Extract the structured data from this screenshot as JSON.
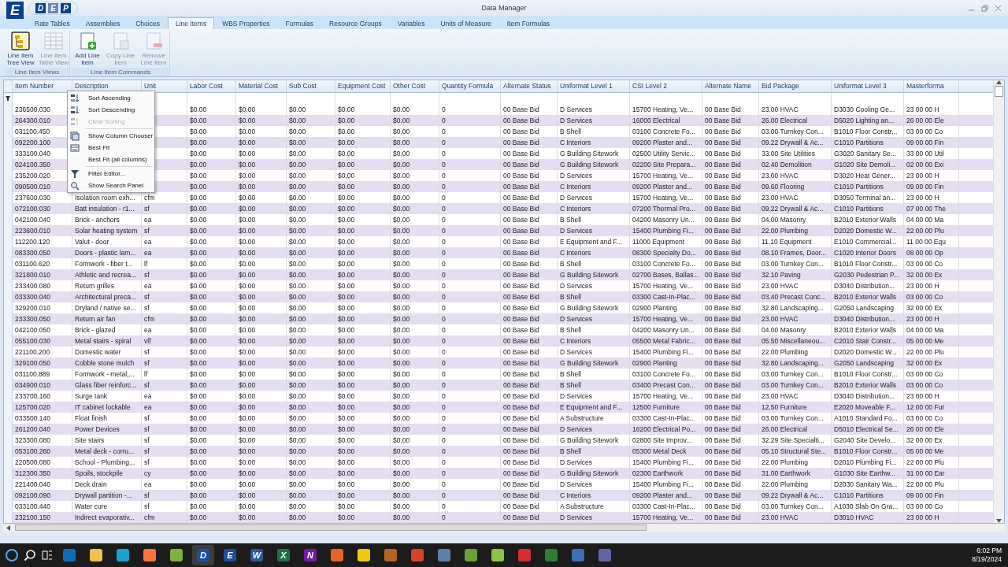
{
  "window": {
    "title": "Data Manager",
    "logo": "E",
    "quick_access": [
      "D",
      "E",
      "P"
    ]
  },
  "tabs": [
    {
      "label": "Rate Tables",
      "selected": false
    },
    {
      "label": "Assemblies",
      "selected": false
    },
    {
      "label": "Choices",
      "selected": false
    },
    {
      "label": "Line Items",
      "selected": true
    },
    {
      "label": "WBS Properties",
      "selected": false
    },
    {
      "label": "Formulas",
      "selected": false
    },
    {
      "label": "Resource Groups",
      "selected": false
    },
    {
      "label": "Variables",
      "selected": false
    },
    {
      "label": "Units of Measure",
      "selected": false
    },
    {
      "label": "Item Formulas",
      "selected": false
    }
  ],
  "ribbon": {
    "groups": [
      {
        "label": "Line Item Views",
        "buttons": [
          {
            "label": "Line Item Tree View",
            "kind": "tree",
            "disabled": false
          },
          {
            "label": "Line Item Table View",
            "kind": "table",
            "disabled": true
          }
        ]
      },
      {
        "label": "Line Item Commands",
        "buttons": [
          {
            "label": "Add Line Item",
            "kind": "add",
            "disabled": false
          },
          {
            "label": "Copy Line Item",
            "kind": "copy",
            "disabled": true
          },
          {
            "label": "Remove Line Item",
            "kind": "remove",
            "disabled": true
          }
        ]
      }
    ]
  },
  "grid": {
    "columns": [
      "Item Number",
      "Description",
      "Unit",
      "Labor Cost",
      "Material Cost",
      "Sub Cost",
      "Equipment Cost",
      "Other Cost",
      "Quantity Formula",
      "Alternate Status",
      "Uniformat Level 1",
      "CSI Level 2",
      "Alternate Name",
      "Bid Package",
      "Uniformat Level 3",
      "Masterforma"
    ],
    "rows": [
      [
        "236500.030",
        null,
        null,
        "$0.00",
        "$0.00",
        "$0.00",
        "$0.00",
        "$0.00",
        "0",
        "00 Base Bid",
        "D Services",
        "15700 Heating, Ve...",
        "00 Base Bid",
        "23.00 HVAC",
        "D3030 Cooling Ge...",
        "23 00 00 H"
      ],
      [
        "264300.010",
        null,
        null,
        "$0.00",
        "$0.00",
        "$0.00",
        "$0.00",
        "$0.00",
        "0",
        "00 Base Bid",
        "D Services",
        "16000 Electrical",
        "00 Base Bid",
        "26.00 Electrical",
        "D5020 Lighting an...",
        "26 00 00 Ele"
      ],
      [
        "031100.450",
        null,
        null,
        "$0.00",
        "$0.00",
        "$0.00",
        "$0.00",
        "$0.00",
        "0",
        "00 Base Bid",
        "B Shell",
        "03100 Concrete Fo...",
        "00 Base Bid",
        "03.00 Turnkey Con...",
        "B1010 Floor Constr...",
        "03 00 00 Co"
      ],
      [
        "092200.100",
        null,
        null,
        "$0.00",
        "$0.00",
        "$0.00",
        "$0.00",
        "$0.00",
        "0",
        "00 Base Bid",
        "C Interiors",
        "09200 Plaster and...",
        "00 Base Bid",
        "09.22 Drywall & Ac...",
        "C1010 Partitions",
        "09 00 00 Fin"
      ],
      [
        "333100.040",
        null,
        null,
        "$0.00",
        "$0.00",
        "$0.00",
        "$0.00",
        "$0.00",
        "0",
        "00 Base Bid",
        "G Building Sitework",
        "02500 Utility Servic...",
        "00 Base Bid",
        "33.00 Site Utilities",
        "G3020 Sanitary Se...",
        "33 00 00 Util"
      ],
      [
        "024100.350",
        null,
        null,
        "$0.00",
        "$0.00",
        "$0.00",
        "$0.00",
        "$0.00",
        "0",
        "00 Base Bid",
        "G Building Sitework",
        "02200 Site Prepara...",
        "00 Base Bid",
        "02.40 Demolition",
        "G1020 Site Demoli...",
        "02 00 00 Exi"
      ],
      [
        "235200.020",
        null,
        null,
        "$0.00",
        "$0.00",
        "$0.00",
        "$0.00",
        "$0.00",
        "0",
        "00 Base Bid",
        "D Services",
        "15700 Heating, Ve...",
        "00 Base Bid",
        "23.00 HVAC",
        "D3020 Heat Gener...",
        "23 00 00 H"
      ],
      [
        "090500.010",
        null,
        null,
        "$0.00",
        "$0.00",
        "$0.00",
        "$0.00",
        "$0.00",
        "0",
        "00 Base Bid",
        "C Interiors",
        "09200 Plaster and...",
        "00 Base Bid",
        "09.60 Flooring",
        "C1010 Partitions",
        "09 00 00 Fin"
      ],
      [
        "237600.030",
        "Isolation room exh...",
        "cfm",
        "$0.00",
        "$0.00",
        "$0.00",
        "$0.00",
        "$0.00",
        "0",
        "00 Base Bid",
        "D Services",
        "15700 Heating, Ve...",
        "00 Base Bid",
        "23.00 HVAC",
        "D3050 Terminal an...",
        "23 00 00 H"
      ],
      [
        "072100.030",
        "Batt insulation - r1...",
        "sf",
        "$0.00",
        "$0.00",
        "$0.00",
        "$0.00",
        "$0.00",
        "0",
        "00 Base Bid",
        "C Interiors",
        "07200 Thermal Pro...",
        "00 Base Bid",
        "09.22 Drywall & Ac...",
        "C1010 Partitions",
        "07 00 00 The"
      ],
      [
        "042100.040",
        "Brick - anchors",
        "ea",
        "$0.00",
        "$0.00",
        "$0.00",
        "$0.00",
        "$0.00",
        "0",
        "00 Base Bid",
        "B Shell",
        "04200 Masonry Un...",
        "00 Base Bid",
        "04.00 Masonry",
        "B2010 Exterior Walls",
        "04 00 00 Ma"
      ],
      [
        "223600.010",
        "Solar heating system",
        "sf",
        "$0.00",
        "$0.00",
        "$0.00",
        "$0.00",
        "$0.00",
        "0",
        "00 Base Bid",
        "D Services",
        "15400 Plumbing Fi...",
        "00 Base Bid",
        "22.00 Plumbing",
        "D2020 Domestic W...",
        "22 00 00 Plu"
      ],
      [
        "112200.120",
        "Valut - door",
        "ea",
        "$0.00",
        "$0.00",
        "$0.00",
        "$0.00",
        "$0.00",
        "0",
        "00 Base Bid",
        "E Equipment and F...",
        "11000 Equipment",
        "00 Base Bid",
        "11.10 Equipment",
        "E1010 Commercial...",
        "11 00 00 Equ"
      ],
      [
        "083300.050",
        "Doors - plastic lam...",
        "ea",
        "$0.00",
        "$0.00",
        "$0.00",
        "$0.00",
        "$0.00",
        "0",
        "00 Base Bid",
        "C Interiors",
        "08300 Specialty Do...",
        "00 Base Bid",
        "08.10 Frames, Door...",
        "C1020 Interior Doors",
        "08 00 00 Op"
      ],
      [
        "031100.620",
        "Formwork - fiber t...",
        "lf",
        "$0.00",
        "$0.00",
        "$0.00",
        "$0.00",
        "$0.00",
        "0",
        "00 Base Bid",
        "B Shell",
        "03100 Concrete Fo...",
        "00 Base Bid",
        "03.00 Turnkey Con...",
        "B1010 Floor Constr...",
        "03 00 00 Co"
      ],
      [
        "321800.010",
        "Athletic and recrea...",
        "sf",
        "$0.00",
        "$0.00",
        "$0.00",
        "$0.00",
        "$0.00",
        "0",
        "00 Base Bid",
        "G Building Sitework",
        "02700 Bases, Ballas...",
        "00 Base Bid",
        "32.10 Paving",
        "G2030 Pedestrian P...",
        "32 00 00 Ex"
      ],
      [
        "233400.080",
        "Return grilles",
        "ea",
        "$0.00",
        "$0.00",
        "$0.00",
        "$0.00",
        "$0.00",
        "0",
        "00 Base Bid",
        "D Services",
        "15700 Heating, Ve...",
        "00 Base Bid",
        "23.00 HVAC",
        "D3040 Distribution...",
        "23 00 00 H"
      ],
      [
        "033300.040",
        "Architectural preca...",
        "sf",
        "$0.00",
        "$0.00",
        "$0.00",
        "$0.00",
        "$0.00",
        "0",
        "00 Base Bid",
        "B Shell",
        "03300 Cast-In-Plac...",
        "00 Base Bid",
        "03.40 Precast Conc...",
        "B2010 Exterior Walls",
        "03 00 00 Co"
      ],
      [
        "329200.010",
        "Dryland / native se...",
        "sf",
        "$0.00",
        "$0.00",
        "$0.00",
        "$0.00",
        "$0.00",
        "0",
        "00 Base Bid",
        "G Building Sitework",
        "02900 Planting",
        "00 Base Bid",
        "32.80 Landscaping...",
        "G2050 Landscaping",
        "32 00 00 Ex"
      ],
      [
        "233300.050",
        "Return air fan",
        "cfm",
        "$0.00",
        "$0.00",
        "$0.00",
        "$0.00",
        "$0.00",
        "0",
        "00 Base Bid",
        "D Services",
        "15700 Heating, Ve...",
        "00 Base Bid",
        "23.00 HVAC",
        "D3040 Distribution...",
        "23 00 00 H"
      ],
      [
        "042100.050",
        "Brick - glazed",
        "ea",
        "$0.00",
        "$0.00",
        "$0.00",
        "$0.00",
        "$0.00",
        "0",
        "00 Base Bid",
        "B Shell",
        "04200 Masonry Un...",
        "00 Base Bid",
        "04.00 Masonry",
        "B2010 Exterior Walls",
        "04 00 00 Ma"
      ],
      [
        "055100.030",
        "Metal stairs - spiral",
        "vlf",
        "$0.00",
        "$0.00",
        "$0.00",
        "$0.00",
        "$0.00",
        "0",
        "00 Base Bid",
        "C Interiors",
        "05500 Metal Fabric...",
        "00 Base Bid",
        "05.50 Miscellaneou...",
        "C2010 Stair Constr...",
        "05 00 00 Me"
      ],
      [
        "221100.200",
        "Domestic water",
        "sf",
        "$0.00",
        "$0.00",
        "$0.00",
        "$0.00",
        "$0.00",
        "0",
        "00 Base Bid",
        "D Services",
        "15400 Plumbing Fi...",
        "00 Base Bid",
        "22.00 Plumbing",
        "D2020 Domestic W...",
        "22 00 00 Plu"
      ],
      [
        "329100.050",
        "Cobble stone mulch",
        "sf",
        "$0.00",
        "$0.00",
        "$0.00",
        "$0.00",
        "$0.00",
        "0",
        "00 Base Bid",
        "G Building Sitework",
        "02900 Planting",
        "00 Base Bid",
        "32.80 Landscaping...",
        "G2050 Landscaping",
        "32 00 00 Ex"
      ],
      [
        "031100.889",
        "Formwork - metal,...",
        "lf",
        "$0.00",
        "$0.00",
        "$0.00",
        "$0.00",
        "$0.00",
        "0",
        "00 Base Bid",
        "B Shell",
        "03100 Concrete Fo...",
        "00 Base Bid",
        "03.00 Turnkey Con...",
        "B1010 Floor Constr...",
        "03 00 00 Co"
      ],
      [
        "034900.010",
        "Glass fiber reinforc...",
        "sf",
        "$0.00",
        "$0.00",
        "$0.00",
        "$0.00",
        "$0.00",
        "0",
        "00 Base Bid",
        "B Shell",
        "03400 Precast Con...",
        "00 Base Bid",
        "03.00 Turnkey Con...",
        "B2010 Exterior Walls",
        "03 00 00 Co"
      ],
      [
        "233700.160",
        "Surge tank",
        "ea",
        "$0.00",
        "$0.00",
        "$0.00",
        "$0.00",
        "$0.00",
        "0",
        "00 Base Bid",
        "D Services",
        "15700 Heating, Ve...",
        "00 Base Bid",
        "23.00 HVAC",
        "D3040 Distribution...",
        "23 00 00 H"
      ],
      [
        "125700.020",
        "IT cabinet lockable",
        "ea",
        "$0.00",
        "$0.00",
        "$0.00",
        "$0.00",
        "$0.00",
        "0",
        "00 Base Bid",
        "E Equipment and F...",
        "12500 Furniture",
        "00 Base Bid",
        "12.50 Furniture",
        "E2020 Moveable F...",
        "12 00 00 Fur"
      ],
      [
        "033500.140",
        "Float finish",
        "sf",
        "$0.00",
        "$0.00",
        "$0.00",
        "$0.00",
        "$0.00",
        "0",
        "00 Base Bid",
        "A Substructure",
        "03300 Cast-In-Plac...",
        "00 Base Bid",
        "03.00 Turnkey Con...",
        "A1010 Standard Fo...",
        "03 00 00 Co"
      ],
      [
        "261200.040",
        "Power Devices",
        "sf",
        "$0.00",
        "$0.00",
        "$0.00",
        "$0.00",
        "$0.00",
        "0",
        "00 Base Bid",
        "D Services",
        "16200 Electrical Po...",
        "00 Base Bid",
        "26.00 Electrical",
        "D5010 Electrical Se...",
        "26 00 00 Ele"
      ],
      [
        "323300.080",
        "Site stairs",
        "sf",
        "$0.00",
        "$0.00",
        "$0.00",
        "$0.00",
        "$0.00",
        "0",
        "00 Base Bid",
        "G Building Sitework",
        "02800 Site Improv...",
        "00 Base Bid",
        "32.29 Site Specialti...",
        "G2040 Site Develo...",
        "32 00 00 Ex"
      ],
      [
        "053100.260",
        "Metal deck - corru...",
        "sf",
        "$0.00",
        "$0.00",
        "$0.00",
        "$0.00",
        "$0.00",
        "0",
        "00 Base Bid",
        "B Shell",
        "05300 Metal Deck",
        "00 Base Bid",
        "05.10 Structural Ste...",
        "B1010 Floor Constr...",
        "05 00 00 Me"
      ],
      [
        "220500.080",
        "School - Plumbing...",
        "sf",
        "$0.00",
        "$0.00",
        "$0.00",
        "$0.00",
        "$0.00",
        "0",
        "00 Base Bid",
        "D Services",
        "15400 Plumbing Fi...",
        "00 Base Bid",
        "22.00 Plumbing",
        "D2010 Plumbing Fi...",
        "22 00 00 Plu"
      ],
      [
        "312300.350",
        "Spoils, stockpile",
        "cy",
        "$0.00",
        "$0.00",
        "$0.00",
        "$0.00",
        "$0.00",
        "0",
        "00 Base Bid",
        "G Building Sitework",
        "02300 Earthwork",
        "00 Base Bid",
        "31.00 Earthwork",
        "G1030 Site Earthw...",
        "31 00 00 Ear"
      ],
      [
        "221400.040",
        "Deck drain",
        "ea",
        "$0.00",
        "$0.00",
        "$0.00",
        "$0.00",
        "$0.00",
        "0",
        "00 Base Bid",
        "D Services",
        "15400 Plumbing Fi...",
        "00 Base Bid",
        "22.00 Plumbing",
        "D2030 Sanitary Wa...",
        "22 00 00 Plu"
      ],
      [
        "092100.090",
        "Drywall partition -...",
        "sf",
        "$0.00",
        "$0.00",
        "$0.00",
        "$0.00",
        "$0.00",
        "0",
        "00 Base Bid",
        "C Interiors",
        "09200 Plaster and...",
        "00 Base Bid",
        "09.22 Drywall & Ac...",
        "C1010 Partitions",
        "09 00 00 Fin"
      ],
      [
        "033100.440",
        "Water cure",
        "sf",
        "$0.00",
        "$0.00",
        "$0.00",
        "$0.00",
        "$0.00",
        "0",
        "00 Base Bid",
        "A Substructure",
        "03300 Cast-In-Plac...",
        "00 Base Bid",
        "03.00 Turnkey Con...",
        "A1030 Slab On Gra...",
        "03 00 00 Co"
      ],
      [
        "232100.150",
        "Indirect evaporativ...",
        "cfm",
        "$0.00",
        "$0.00",
        "$0.00",
        "$0.00",
        "$0.00",
        "0",
        "00 Base Bid",
        "D Services",
        "15700 Heating, Ve...",
        "00 Base Bid",
        "23.00 HVAC",
        "D3010 HVAC",
        "23 00 00 H"
      ]
    ]
  },
  "context_menu": {
    "groups": [
      [
        {
          "label": "Sort Ascending",
          "kind": "sort-asc",
          "disabled": false
        },
        {
          "label": "Sort Descending",
          "kind": "sort-desc",
          "disabled": false
        },
        {
          "label": "Clear Sorting",
          "kind": "clear-sort",
          "disabled": true
        }
      ],
      [
        {
          "label": "Show Column Chooser",
          "kind": "columns",
          "disabled": false
        },
        {
          "label": "Best Fit",
          "kind": "best-fit",
          "disabled": false
        },
        {
          "label": "Best Fit (all columns)",
          "kind": "none",
          "disabled": false
        }
      ],
      [
        {
          "label": "Filter Editor...",
          "kind": "filter",
          "disabled": false
        },
        {
          "label": "Show Search Panel",
          "kind": "search",
          "disabled": false
        }
      ]
    ]
  },
  "taskbar": {
    "apps": [
      {
        "kind": "start"
      },
      {
        "kind": "search"
      },
      {
        "kind": "taskview"
      },
      {
        "kind": "tile",
        "color": "#0f6cbd",
        "selected": false
      },
      {
        "kind": "tile",
        "color": "#f2c14e",
        "selected": false
      },
      {
        "kind": "tile",
        "color": "#1fa2c9",
        "selected": false
      },
      {
        "kind": "tile",
        "color": "#ff7139",
        "selected": false
      },
      {
        "kind": "tile",
        "color": "#7cb342",
        "selected": false
      },
      {
        "kind": "tile",
        "color": "#1c4ea0",
        "label": "D",
        "selected": true
      },
      {
        "kind": "tile",
        "color": "#1c4ea0",
        "label": "E",
        "selected": false
      },
      {
        "kind": "tile",
        "color": "#2b5797",
        "label": "W",
        "selected": false
      },
      {
        "kind": "tile",
        "color": "#1e7145",
        "label": "X",
        "selected": false
      },
      {
        "kind": "tile",
        "color": "#7719aa",
        "label": "N",
        "selected": false
      },
      {
        "kind": "tile",
        "color": "#e8632b",
        "selected": false
      },
      {
        "kind": "tile",
        "color": "#f2c811",
        "selected": false
      },
      {
        "kind": "tile",
        "color": "#b5651d",
        "selected": false
      },
      {
        "kind": "tile",
        "color": "#d9412b",
        "selected": false
      },
      {
        "kind": "tile",
        "color": "#5b7fa6",
        "selected": false
      },
      {
        "kind": "tile",
        "color": "#6a9f3a",
        "selected": false
      },
      {
        "kind": "tile",
        "color": "#8bc34a",
        "selected": false
      },
      {
        "kind": "tile",
        "color": "#d32f2f",
        "selected": false
      },
      {
        "kind": "tile",
        "color": "#2e7d32",
        "selected": false
      },
      {
        "kind": "tile",
        "color": "#3f6fb5",
        "selected": false
      },
      {
        "kind": "tile",
        "color": "#6264a7",
        "selected": false
      }
    ],
    "time": "6:02 PM",
    "date": "8/19/2024"
  }
}
